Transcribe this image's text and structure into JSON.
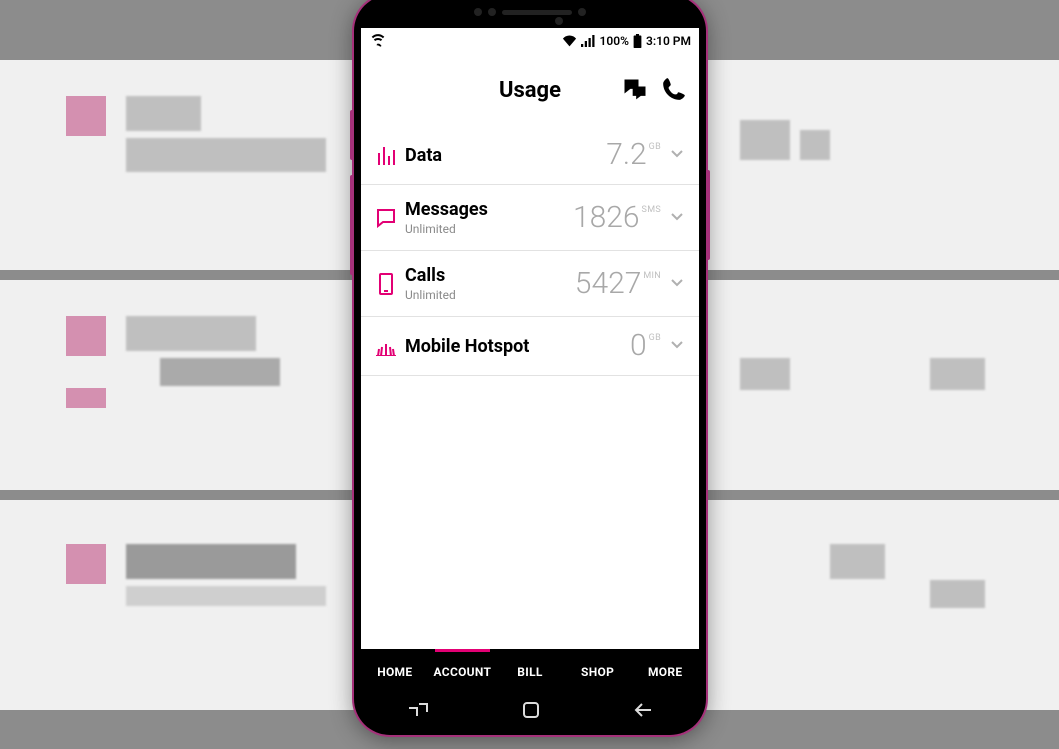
{
  "status": {
    "battery_pct": "100%",
    "time": "3:10 PM"
  },
  "header": {
    "title": "Usage"
  },
  "rows": [
    {
      "icon": "bars-icon",
      "label": "Data",
      "sub": "",
      "value": "7.2",
      "unit": "GB"
    },
    {
      "icon": "message-icon",
      "label": "Messages",
      "sub": "Unlimited",
      "value": "1826",
      "unit": "SMS"
    },
    {
      "icon": "phone-rect-icon",
      "label": "Calls",
      "sub": "Unlimited",
      "value": "5427",
      "unit": "MIN"
    },
    {
      "icon": "hotspot-icon",
      "label": "Mobile Hotspot",
      "sub": "",
      "value": "0",
      "unit": "GB"
    }
  ],
  "tabs": [
    {
      "label": "HOME",
      "active": false
    },
    {
      "label": "ACCOUNT",
      "active": true
    },
    {
      "label": "BILL",
      "active": false
    },
    {
      "label": "SHOP",
      "active": false
    },
    {
      "label": "MORE",
      "active": false
    }
  ],
  "colors": {
    "brand": "#e20074"
  }
}
